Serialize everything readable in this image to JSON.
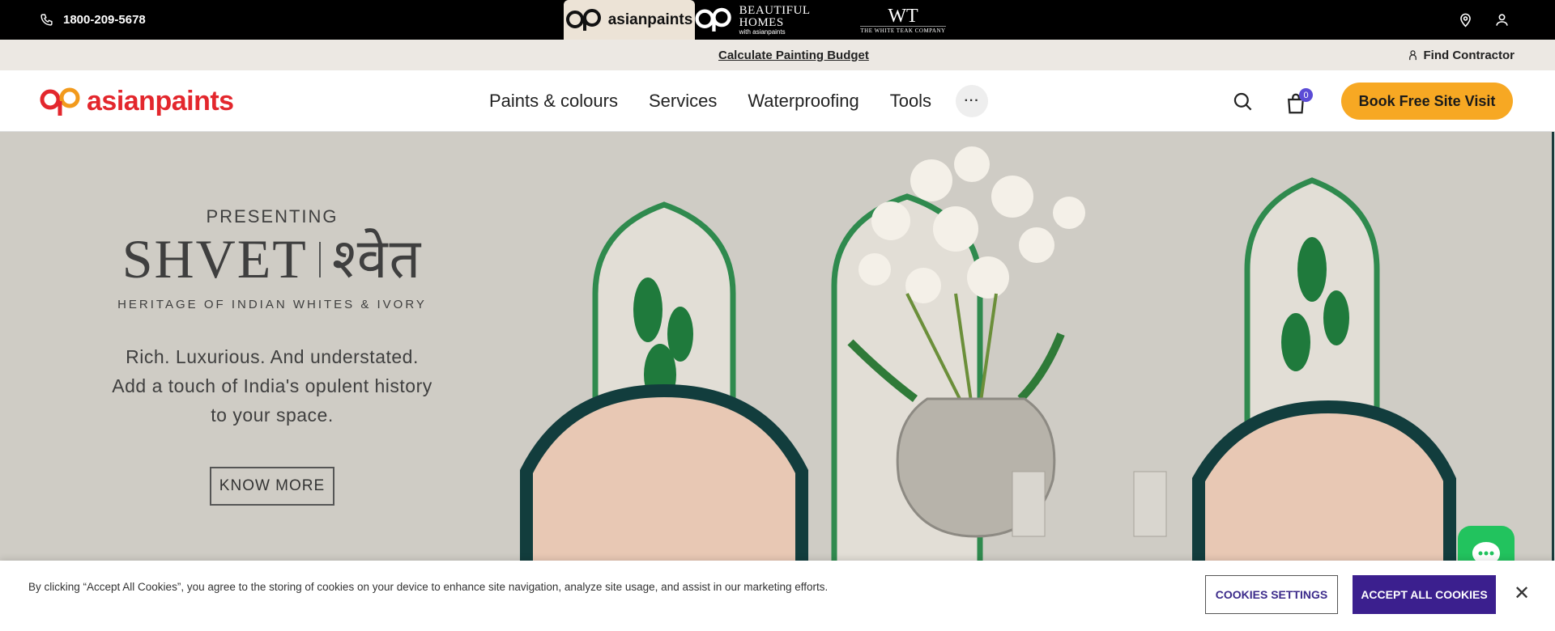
{
  "topbar": {
    "phone": "1800-209-5678",
    "brands": [
      {
        "name": "asianpaints",
        "active": true
      },
      {
        "name": "BEAUTIFUL HOMES",
        "sub": "with asianpaints"
      },
      {
        "name": "WT",
        "sub": "THE WHITE TEAK COMPANY"
      }
    ]
  },
  "utility": {
    "calculate_link": "Calculate Painting Budget",
    "find_contractor": "Find Contractor"
  },
  "header": {
    "logo_text": "asianpaints",
    "nav": [
      "Paints & colours",
      "Services",
      "Waterproofing",
      "Tools"
    ],
    "more": "···",
    "cart_count": "0",
    "cta": "Book Free Site Visit"
  },
  "hero": {
    "presenting": "PRESENTING",
    "title_latin": "SHVET",
    "title_devanagari": "श्वेत",
    "subtitle": "HERITAGE OF INDIAN WHITES & IVORY",
    "tagline_1": "Rich. Luxurious. And understated.",
    "tagline_2": "Add a touch of India's opulent history",
    "tagline_3": "to your space.",
    "cta": "KNOW MORE"
  },
  "cookie": {
    "text": "By clicking “Accept All Cookies”, you agree to the storing of cookies on your device to enhance site navigation, analyze site usage, and assist in our marketing efforts.",
    "settings_label": "COOKIES SETTINGS",
    "accept_label": "ACCEPT ALL COOKIES",
    "close": "✕"
  },
  "colors": {
    "brand_red": "#e3272d",
    "cta_orange": "#f7a823",
    "cookie_purple": "#3b1f8e",
    "chat_green": "#22c35e"
  }
}
